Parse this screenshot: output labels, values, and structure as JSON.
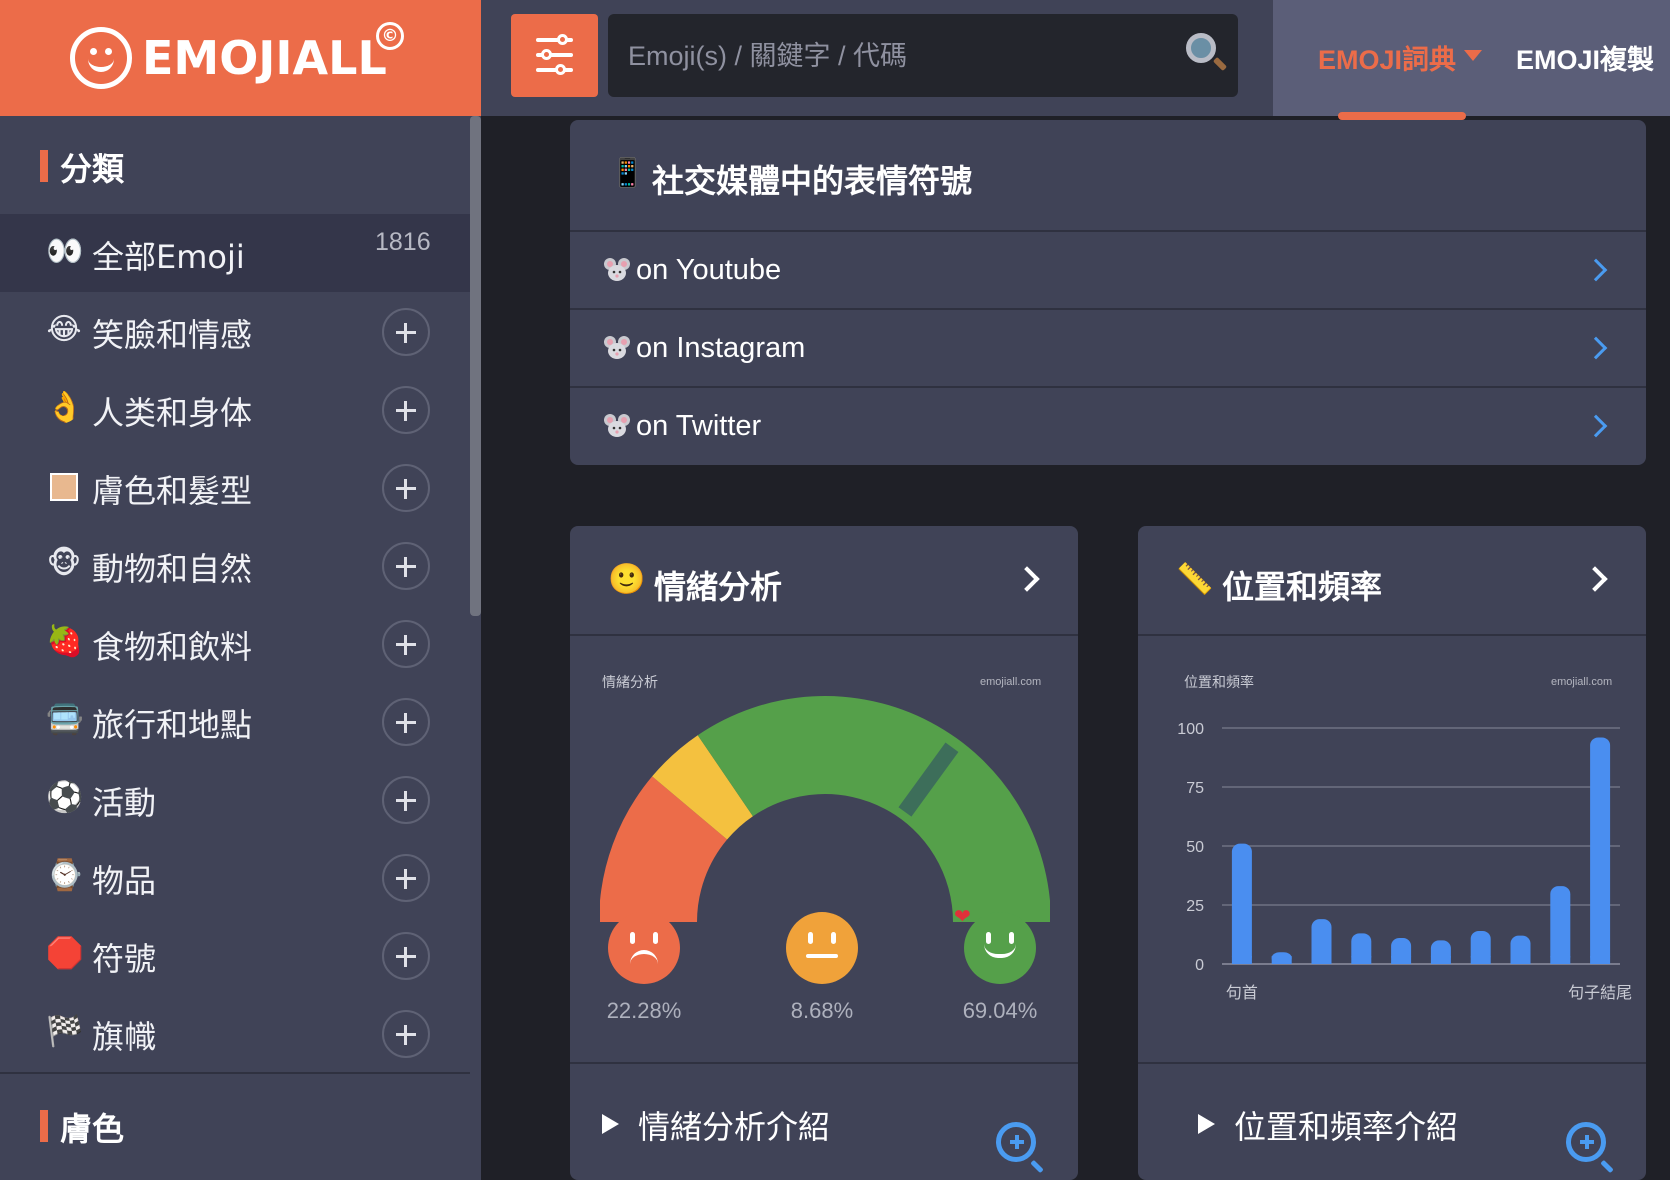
{
  "header": {
    "logo_text": "EMOJIALL",
    "logo_mark": "©",
    "search_placeholder": "Emoji(s) / 關鍵字 / 代碼",
    "nav": {
      "dictionary": "EMOJI詞典",
      "copy": "EMOJI複製"
    }
  },
  "sidebar": {
    "section_title": "分類",
    "all_item": {
      "emoji": "👀",
      "label": "全部Emoji",
      "count": "1816"
    },
    "items": [
      {
        "emoji": "😂",
        "label": "笑臉和情感"
      },
      {
        "emoji": "👌",
        "label": "人类和身体"
      },
      {
        "emoji": "🟫",
        "label": "膚色和髮型"
      },
      {
        "emoji": "🐵",
        "label": "動物和自然"
      },
      {
        "emoji": "🍓",
        "label": "食物和飲料"
      },
      {
        "emoji": "🚍",
        "label": "旅行和地點"
      },
      {
        "emoji": "⚽",
        "label": "活動"
      },
      {
        "emoji": "⌚",
        "label": "物品"
      },
      {
        "emoji": "🛑",
        "label": "符號"
      },
      {
        "emoji": "🏁",
        "label": "旗幟"
      }
    ],
    "section2_title": "膚色"
  },
  "social": {
    "icon_emoji": "📱",
    "title": "社交媒體中的表情符號",
    "rows": [
      {
        "label": "on Youtube"
      },
      {
        "label": "on Instagram"
      },
      {
        "label": "on Twitter"
      }
    ]
  },
  "sentiment": {
    "icon_emoji": "🙂",
    "title": "情緒分析",
    "chart_label": "情緒分析",
    "watermark": "emojiall.com",
    "negative_pct": "22.28%",
    "neutral_pct": "8.68%",
    "positive_pct": "69.04%",
    "gauge_value": 0.7,
    "footer_title": "情緒分析介紹",
    "colors": {
      "negative": "#ec6c49",
      "neutral": "#f4c13f",
      "positive": "#55a04a"
    }
  },
  "position": {
    "icon_emoji": "📏",
    "title": "位置和頻率",
    "footer_title": "位置和頻率介紹",
    "chart_data": {
      "type": "bar",
      "title": "位置和頻率",
      "watermark": "emojiall.com",
      "categories": [
        "句首",
        "",
        "",
        "",
        "",
        "",
        "",
        "",
        "",
        "句子結尾"
      ],
      "values": [
        51,
        5,
        19,
        13,
        11,
        10,
        14,
        12,
        33,
        96
      ],
      "ylim": [
        0,
        100
      ],
      "yticks": [
        "100",
        "75",
        "50",
        "25",
        "0"
      ],
      "bar_color": "#4a8ef0",
      "grid": true
    }
  }
}
